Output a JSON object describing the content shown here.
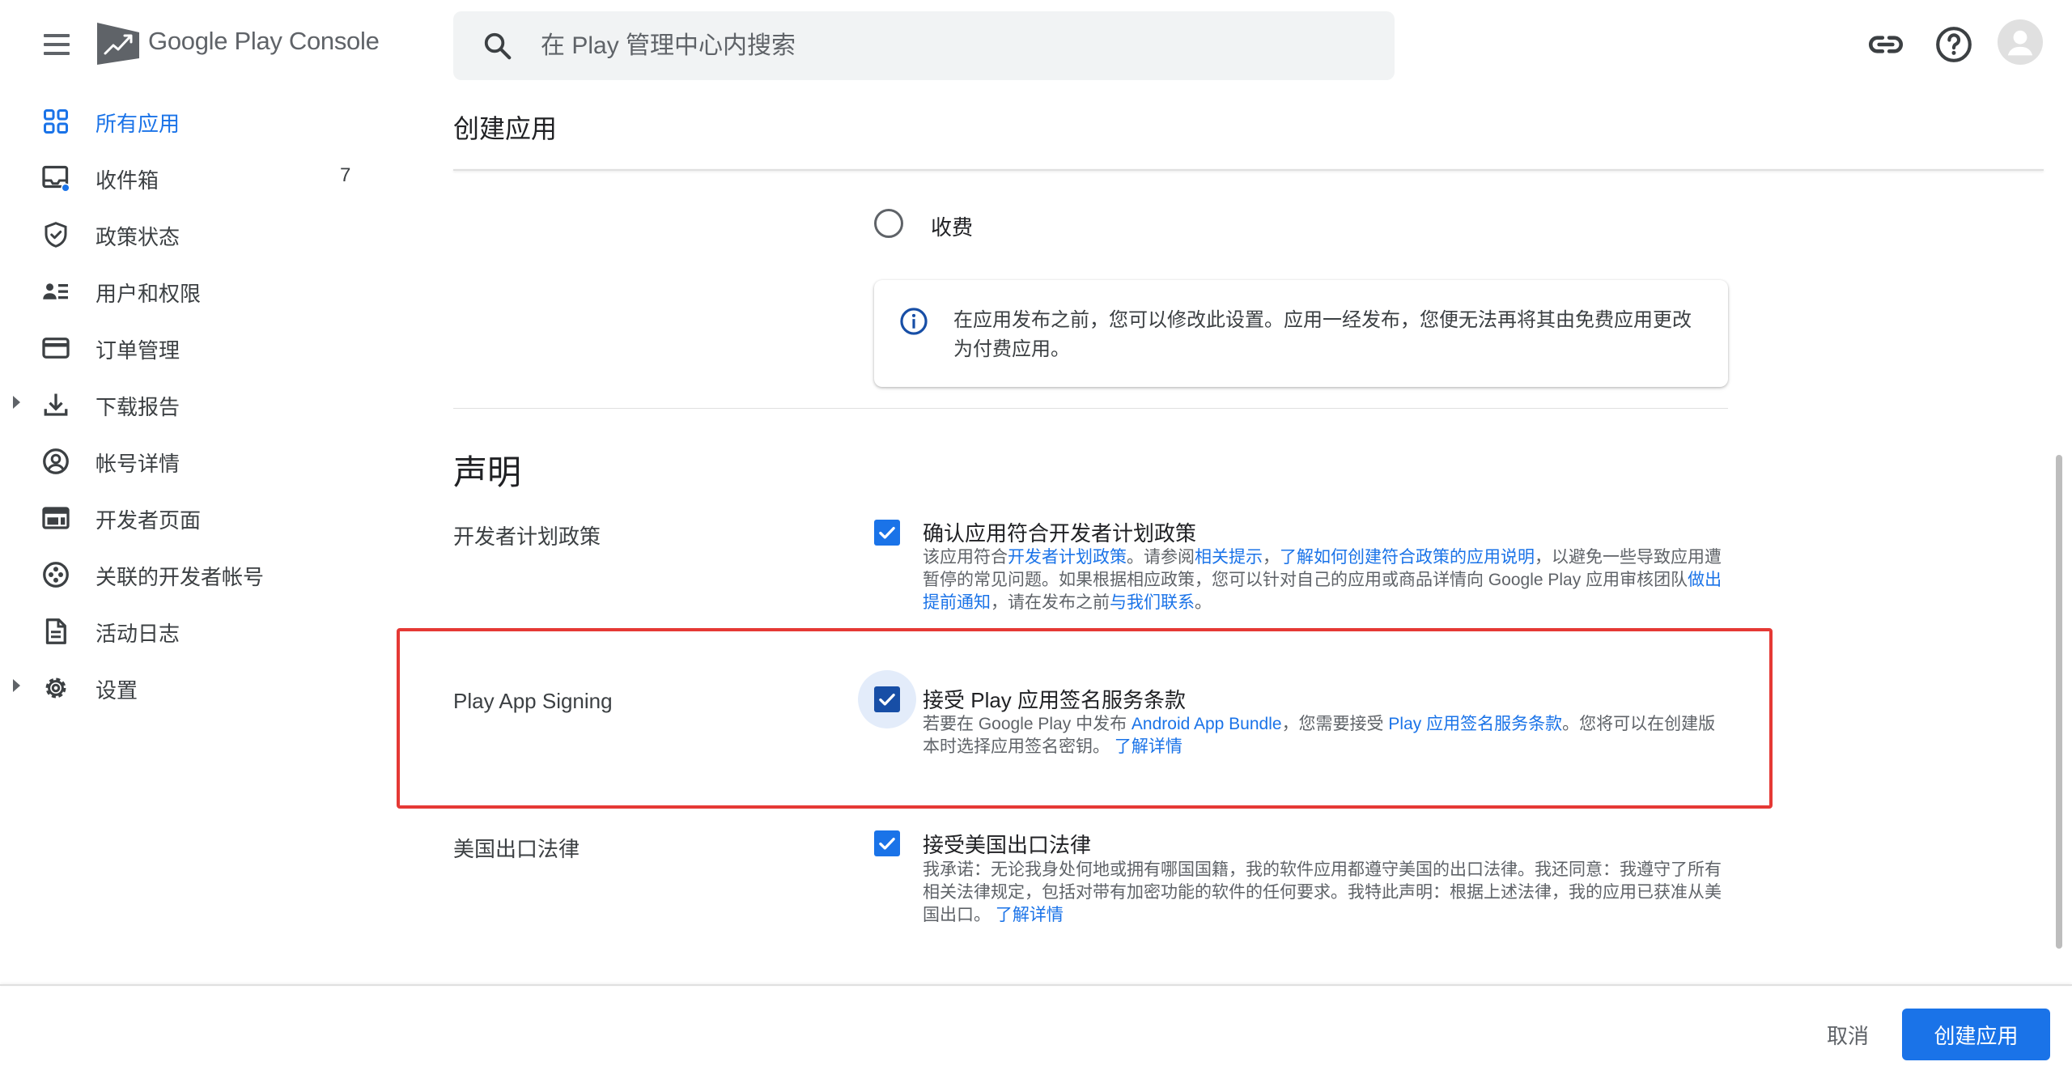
{
  "app": {
    "brand": "Google Play Console",
    "accent_color": "#1a73e8",
    "highlight_color": "#e53935"
  },
  "search": {
    "placeholder": "在 Play 管理中心内搜索",
    "value": ""
  },
  "topbar_icons": [
    "link-icon",
    "help-icon",
    "account-avatar"
  ],
  "sidebar": {
    "items": [
      {
        "label": "所有应用",
        "icon": "apps-grid-icon",
        "active": true
      },
      {
        "label": "收件箱",
        "icon": "inbox-icon",
        "count": "7"
      },
      {
        "label": "政策状态",
        "icon": "shield-check-icon"
      },
      {
        "label": "用户和权限",
        "icon": "users-icon"
      },
      {
        "label": "订单管理",
        "icon": "credit-card-icon"
      },
      {
        "label": "下载报告",
        "icon": "download-icon",
        "expandable": true
      },
      {
        "label": "帐号详情",
        "icon": "account-circle-icon"
      },
      {
        "label": "开发者页面",
        "icon": "web-page-icon"
      },
      {
        "label": "关联的开发者帐号",
        "icon": "linked-accounts-icon"
      },
      {
        "label": "活动日志",
        "icon": "document-icon"
      },
      {
        "label": "设置",
        "icon": "gear-icon",
        "expandable": true
      }
    ]
  },
  "main": {
    "title": "创建应用",
    "pricing": {
      "option_label": "收费",
      "info_text": "在应用发布之前，您可以修改此设置。应用一经发布，您便无法再将其由免费应用更改为付费应用。"
    },
    "declarations": {
      "title": "声明",
      "rows": [
        {
          "label": "开发者计划政策",
          "checked": true,
          "checkbox_title": "确认应用符合开发者计划政策",
          "desc": [
            {
              "t": "该应用符合"
            },
            {
              "link": "开发者计划政策"
            },
            {
              "t": "。请参阅"
            },
            {
              "link": "相关提示"
            },
            {
              "t": "，"
            },
            {
              "link": "了解如何创建符合政策的应用说明"
            },
            {
              "t": "，以避免一些导致应用遭暂停的常见问题。如果根据相应政策，您可以针对自己的应用或商品详情向 Google Play 应用审核团队"
            },
            {
              "link": "做出提前通知"
            },
            {
              "t": "，请在发布之前"
            },
            {
              "link": "与我们联系"
            },
            {
              "t": "。"
            }
          ]
        },
        {
          "label": "Play App Signing",
          "checked": true,
          "checkbox_title": "接受 Play 应用签名服务条款",
          "desc": [
            {
              "t": "若要在 Google Play 中发布 "
            },
            {
              "link": "Android App Bundle"
            },
            {
              "t": "，您需要接受 "
            },
            {
              "link": "Play 应用签名服务条款"
            },
            {
              "t": "。您将可以在创建版本时选择应用签名密钥。 "
            },
            {
              "link": "了解详情"
            }
          ]
        },
        {
          "label": "美国出口法律",
          "checked": true,
          "checkbox_title": "接受美国出口法律",
          "desc": [
            {
              "t": "我承诺：无论我身处何地或拥有哪国国籍，我的软件应用都遵守美国的出口法律。我还同意：我遵守了所有相关法律规定，包括对带有加密功能的软件的任何要求。我特此声明：根据上述法律，我的应用已获准从美国出口。 "
            },
            {
              "link": "了解详情"
            }
          ]
        }
      ]
    }
  },
  "footer": {
    "cancel_label": "取消",
    "create_label": "创建应用"
  }
}
